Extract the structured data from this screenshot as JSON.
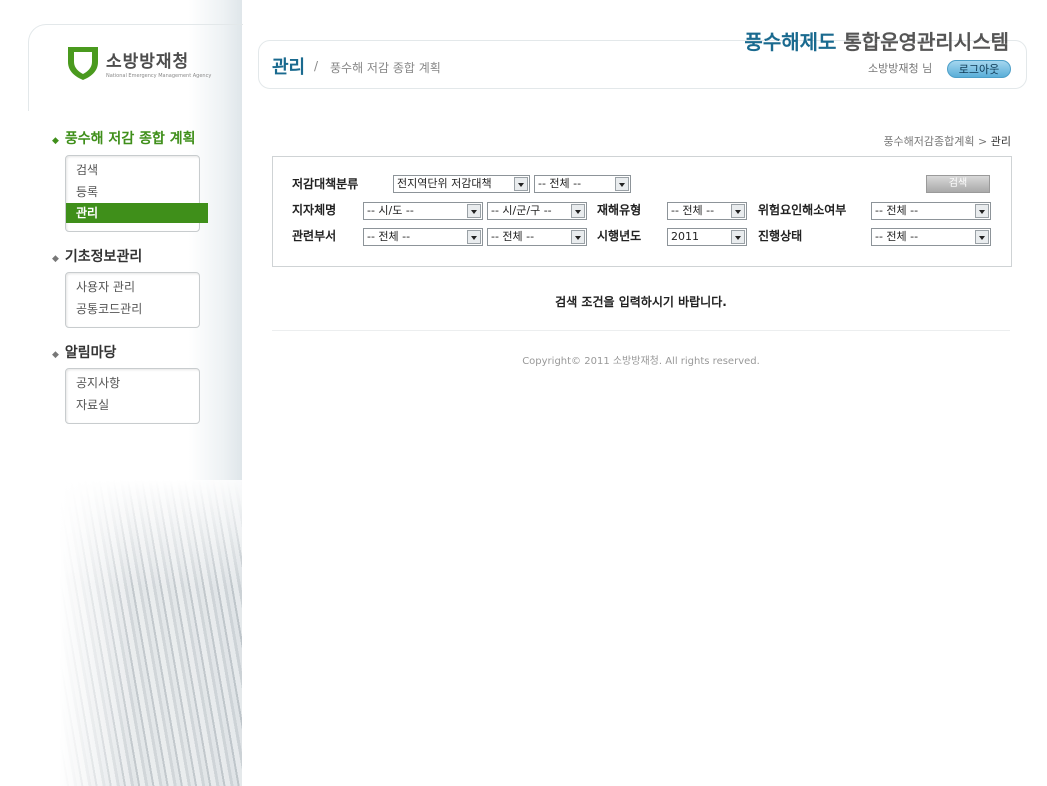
{
  "brand": {
    "logo_text": "소방방재청",
    "logo_subtext": "National Emergency Management Agency",
    "system_title_part1": "풍수해제도",
    "system_title_part2": "통합운영관리시스템"
  },
  "header": {
    "heading": "관리",
    "separator": "/",
    "subheading": "풍수해 저감 종합 계획",
    "user_name": "소방방재청 님",
    "logout_label": "로그아웃"
  },
  "sidebar": {
    "sections": [
      {
        "title": "풍수해 저감 종합 계획",
        "items": [
          "검색",
          "등록",
          "관리"
        ],
        "selected": "관리"
      },
      {
        "title": "기초정보관리",
        "items": [
          "사용자 관리",
          "공통코드관리"
        ]
      },
      {
        "title": "알림마당",
        "items": [
          "공지사항",
          "자료실"
        ]
      }
    ]
  },
  "breadcrumb": {
    "parent": "풍수해저감종합계획",
    "separator": ">",
    "current": "관리"
  },
  "search": {
    "labels": {
      "category": "저감대책분류",
      "municipality": "지자체명",
      "disaster_type": "재해유형",
      "risk_factor": "위험요인해소여부",
      "department": "관련부서",
      "year": "시행년도",
      "status": "진행상태"
    },
    "values": {
      "category1": "전지역단위 저감대책",
      "category2": "-- 전체 --",
      "sido": "-- 시/도 --",
      "sigungu": "-- 시/군/구 --",
      "disaster_type": "-- 전체 --",
      "risk_factor": "-- 전체 --",
      "department1": "-- 전체 --",
      "department2": "-- 전체 --",
      "year": "2011",
      "status": "-- 전체 --"
    },
    "button_label": "검색"
  },
  "notice": "검색 조건을 입력하시기 바랍니다.",
  "copyright": "Copyright© 2011 소방방재청. All rights reserved."
}
